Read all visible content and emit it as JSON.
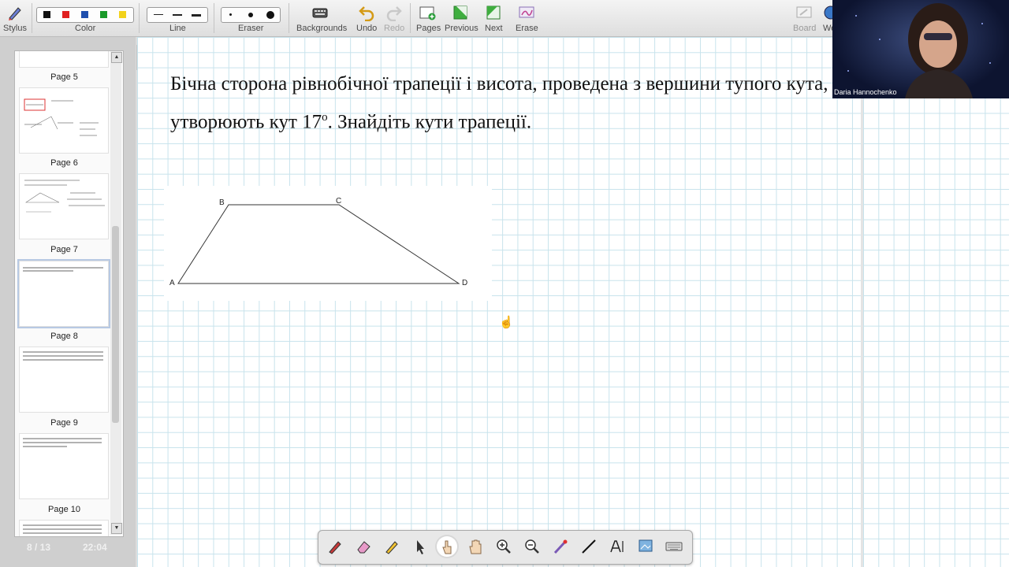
{
  "toolbar": {
    "stylus_label": "Stylus",
    "color_label": "Color",
    "line_label": "Line",
    "eraser_label": "Eraser",
    "backgrounds_label": "Backgrounds",
    "undo_label": "Undo",
    "redo_label": "Redo",
    "pages_label": "Pages",
    "previous_label": "Previous",
    "next_label": "Next",
    "erase_label": "Erase",
    "board_label": "Board",
    "web_label": "We",
    "colors": [
      "#111111",
      "#e02020",
      "#1f4fae",
      "#1a9a2a",
      "#f2d21b"
    ]
  },
  "sidebar": {
    "pages": [
      {
        "label": "Page 5"
      },
      {
        "label": "Page 6"
      },
      {
        "label": "Page 7"
      },
      {
        "label": "Page 8"
      },
      {
        "label": "Page 9"
      },
      {
        "label": "Page 10"
      }
    ],
    "page_counter": "8 / 13",
    "clock": "22:04"
  },
  "board": {
    "problem_text_1": "Бічна сторона рівнобічної трапеції і висота, проведена з вершини тупого кута, утворюють кут 17",
    "problem_degree": "о",
    "problem_text_2": ". Знайдіть кути трапеції.",
    "figure": {
      "vertex_a": "A",
      "vertex_b": "B",
      "vertex_c": "C",
      "vertex_d": "D"
    }
  },
  "webcam": {
    "participant_name": "Daria Hannochenko"
  }
}
